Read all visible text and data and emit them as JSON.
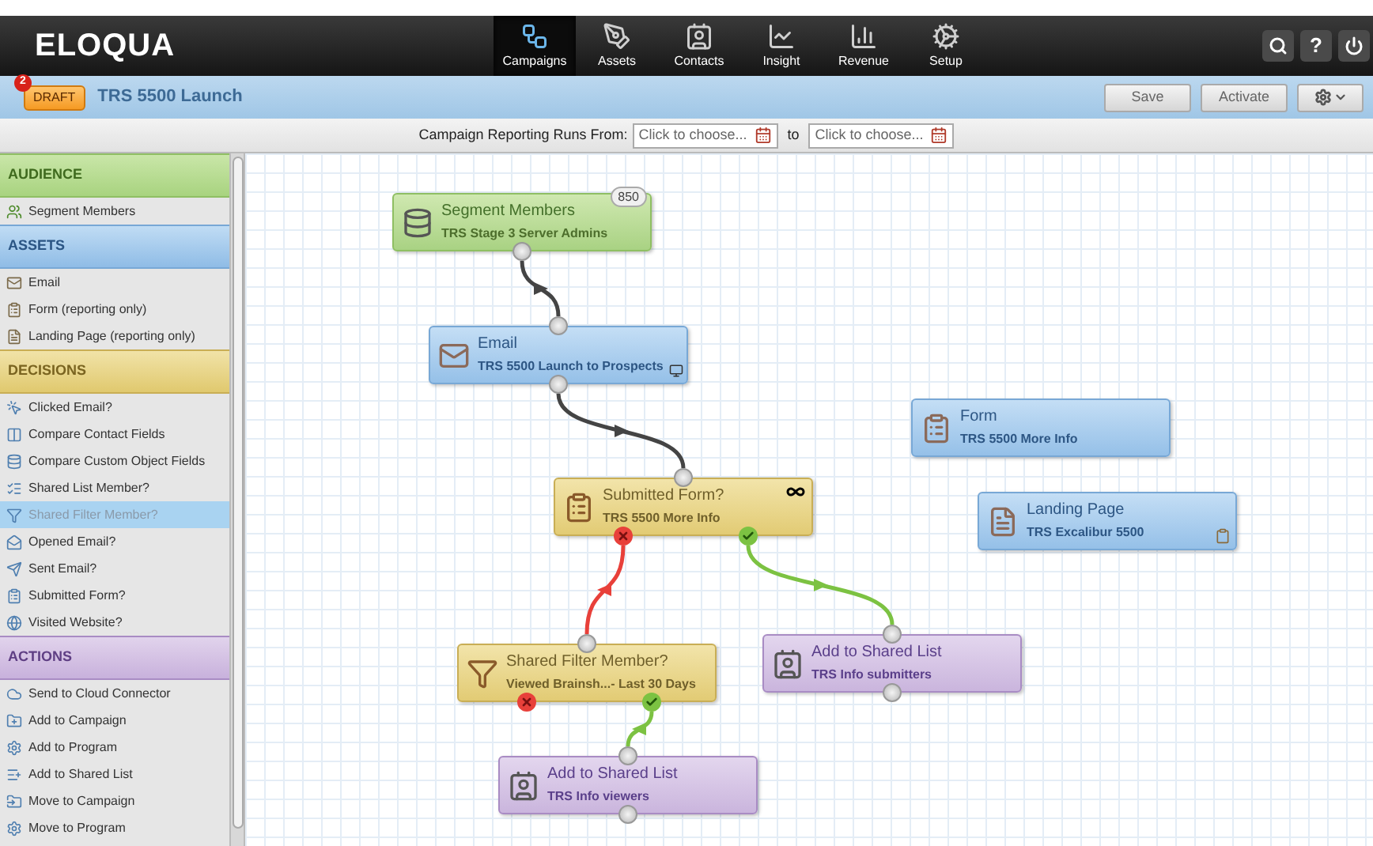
{
  "header": {
    "logo": "ELOQUA",
    "nav": [
      {
        "label": "Campaigns",
        "selected": true
      },
      {
        "label": "Assets",
        "selected": false
      },
      {
        "label": "Contacts",
        "selected": false
      },
      {
        "label": "Insight",
        "selected": false
      },
      {
        "label": "Revenue",
        "selected": false
      },
      {
        "label": "Setup",
        "selected": false
      }
    ],
    "help_button": "?"
  },
  "campaign_bar": {
    "status": "DRAFT",
    "notification_count": "2",
    "title": "TRS 5500 Launch",
    "buttons": [
      "Save",
      "Activate"
    ]
  },
  "reporting_bar": {
    "label": "Campaign Reporting Runs From:",
    "from_field": {
      "placeholder": "Click to choose..."
    },
    "separator": "to",
    "to_field": {
      "placeholder": "Click to choose..."
    }
  },
  "sidebar": [
    {
      "kind": "audience",
      "title": "AUDIENCE",
      "items": [
        {
          "label": "Segment Members",
          "selected": false
        }
      ]
    },
    {
      "kind": "assets",
      "title": "ASSETS",
      "items": [
        {
          "label": "Email",
          "selected": false
        },
        {
          "label": "Form (reporting only)",
          "selected": false
        },
        {
          "label": "Landing Page (reporting only)",
          "selected": false
        }
      ]
    },
    {
      "kind": "decisions",
      "title": "DECISIONS",
      "items": [
        {
          "label": "Clicked Email?",
          "selected": false
        },
        {
          "label": "Compare Contact Fields",
          "selected": false
        },
        {
          "label": "Compare Custom Object Fields",
          "selected": false
        },
        {
          "label": "Shared List Member?",
          "selected": false
        },
        {
          "label": "Shared Filter Member?",
          "selected": true
        },
        {
          "label": "Opened Email?",
          "selected": false
        },
        {
          "label": "Sent Email?",
          "selected": false
        },
        {
          "label": "Submitted Form?",
          "selected": false
        },
        {
          "label": "Visited Website?",
          "selected": false
        }
      ]
    },
    {
      "kind": "actions",
      "title": "ACTIONS",
      "items": [
        {
          "label": "Send to Cloud Connector",
          "selected": false
        },
        {
          "label": "Add to Campaign",
          "selected": false
        },
        {
          "label": "Add to Program",
          "selected": false
        },
        {
          "label": "Add to Shared List",
          "selected": false
        },
        {
          "label": "Move to Campaign",
          "selected": false
        },
        {
          "label": "Move to Program",
          "selected": false
        }
      ]
    }
  ],
  "canvas": {
    "nodes": [
      {
        "kind": "audience",
        "title": "Segment Members",
        "subtitle": "TRS Stage 3 Server Admins",
        "badge": "850",
        "connected": true
      },
      {
        "kind": "asset",
        "title": "Email",
        "subtitle": "TRS 5500 Launch to Prospects",
        "connected": true
      },
      {
        "kind": "asset",
        "title": "Form",
        "subtitle": "TRS 5500 More Info",
        "connected": false
      },
      {
        "kind": "decision",
        "title": "Submitted Form?",
        "subtitle": "TRS 5500 More Info",
        "connected": true
      },
      {
        "kind": "asset",
        "title": "Landing Page",
        "subtitle": "TRS Excalibur 5500",
        "connected": false
      },
      {
        "kind": "decision",
        "title": "Shared Filter Member?",
        "subtitle": "Viewed Brainsh...- Last 30 Days",
        "connected": true
      },
      {
        "kind": "action",
        "title": "Add to Shared List",
        "subtitle": "TRS Info submitters",
        "connected": true
      },
      {
        "kind": "action",
        "title": "Add to Shared List",
        "subtitle": "TRS Info viewers",
        "connected": true
      }
    ],
    "connectors": [
      {
        "kind": "plain"
      },
      {
        "kind": "plain"
      },
      {
        "kind": "no"
      },
      {
        "kind": "yes"
      },
      {
        "kind": "yes"
      }
    ]
  }
}
